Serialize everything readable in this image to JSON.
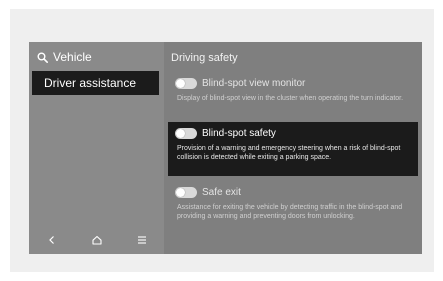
{
  "sidebar": {
    "header_label": "Vehicle",
    "header_icon": "search-icon",
    "selected_item": "Driver assistance"
  },
  "bottom_nav": {
    "back_icon": "back-chevron-icon",
    "home_icon": "home-icon",
    "menu_icon": "menu-icon"
  },
  "content": {
    "title": "Driving safety",
    "options": [
      {
        "label": "Blind-spot view monitor",
        "description": "Display of blind-spot view in the cluster when operating the turn indicator.",
        "enabled": false,
        "selected": false
      },
      {
        "label": "Blind-spot safety",
        "description": "Provision of a warning and emergency steering when a risk of blind-spot collision is detected while exiting a parking space.",
        "enabled": false,
        "selected": true
      },
      {
        "label": "Safe exit",
        "description": "Assistance for exiting the vehicle by detecting traffic in the blind-spot and providing a warning and preventing doors from unlocking.",
        "enabled": false,
        "selected": false
      }
    ]
  },
  "colors": {
    "screen_bg": "#7f7f7f",
    "sidebar_bg": "#8a8a8a",
    "selected_bg": "#1b1b1b",
    "text": "#ffffff"
  }
}
